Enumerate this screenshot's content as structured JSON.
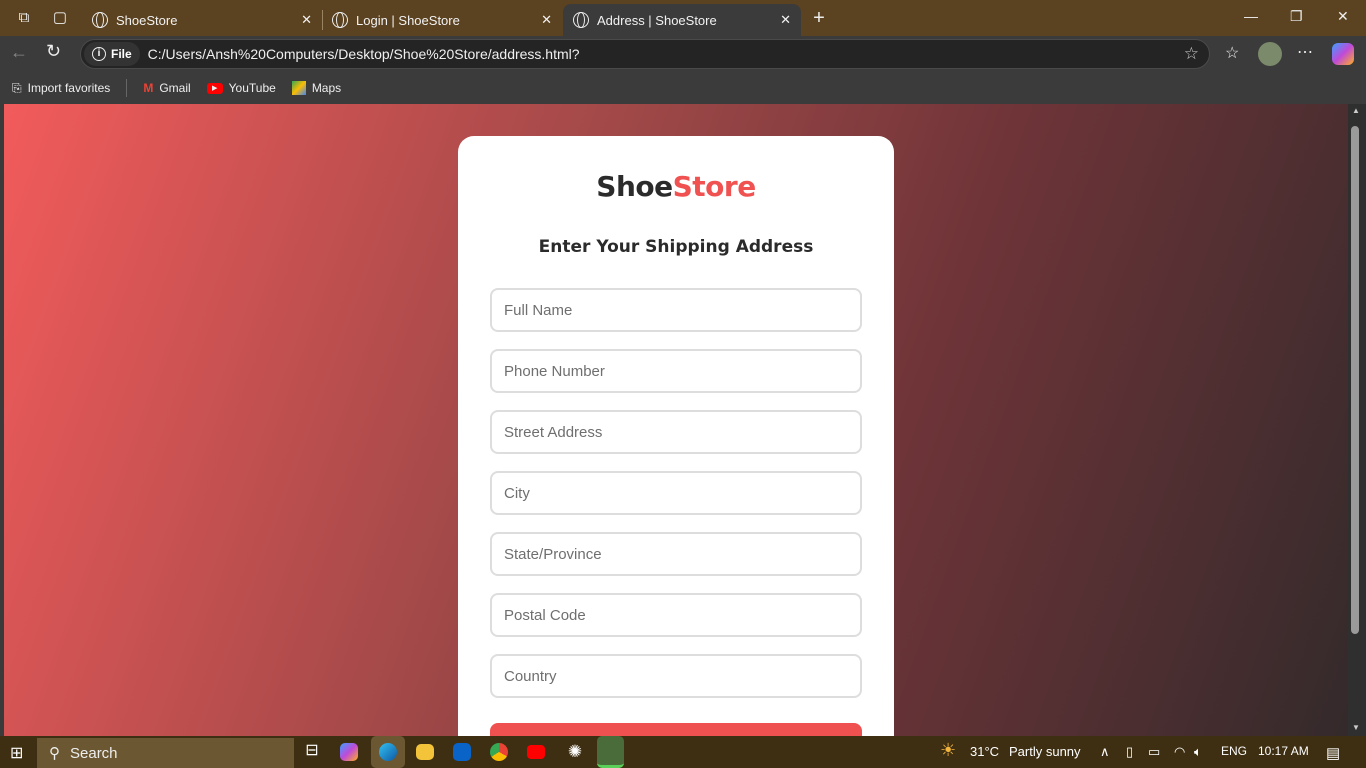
{
  "browser": {
    "tabs": [
      {
        "title": "ShoeStore"
      },
      {
        "title": "Login | ShoeStore"
      },
      {
        "title": "Address | ShoeStore",
        "active": true
      }
    ],
    "address": {
      "scheme_label": "File",
      "url": "C:/Users/Ansh%20Computers/Desktop/Shoe%20Store/address.html?"
    },
    "bookmarks": [
      {
        "label": "Import favorites"
      },
      {
        "label": "Gmail"
      },
      {
        "label": "YouTube"
      },
      {
        "label": "Maps"
      }
    ]
  },
  "page": {
    "logo": {
      "part1": "Shoe",
      "part2": "Store"
    },
    "heading": "Enter Your Shipping Address",
    "fields": [
      {
        "placeholder": "Full Name",
        "value": ""
      },
      {
        "placeholder": "Phone Number",
        "value": ""
      },
      {
        "placeholder": "Street Address",
        "value": ""
      },
      {
        "placeholder": "City",
        "value": ""
      },
      {
        "placeholder": "State/Province",
        "value": ""
      },
      {
        "placeholder": "Postal Code",
        "value": ""
      },
      {
        "placeholder": "Country",
        "value": ""
      }
    ],
    "colors": {
      "accent": "#ef5050",
      "gradient_start": "#f25b5b",
      "gradient_end": "#342a2b"
    }
  },
  "taskbar": {
    "search_label": "Search",
    "weather": {
      "temp": "31°C",
      "condition": "Partly sunny"
    },
    "language": "ENG",
    "time": "10:17 AM"
  }
}
